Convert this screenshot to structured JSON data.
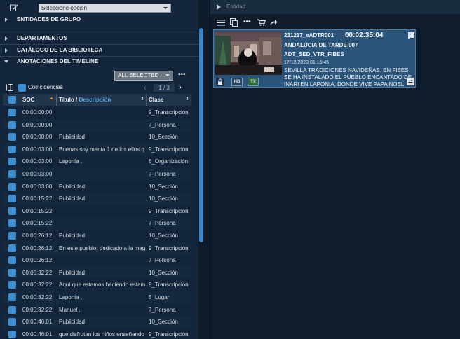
{
  "left": {
    "selector": {
      "value": "Seleccione opción"
    },
    "sections": [
      {
        "label": "ENTIDADES DE GRUPO",
        "expanded": false
      },
      {
        "label": "DEPARTAMENTOS",
        "expanded": false
      },
      {
        "label": "CATÁLOGO DE LA BIBLIOTECA",
        "expanded": false
      },
      {
        "label": "ANOTACIONES DEL TIMELINE",
        "expanded": true
      }
    ],
    "filter": {
      "value": "ALL SELECTED",
      "more": "•••"
    },
    "coincidencias": {
      "label": "Coincidencias",
      "page": "1 / 3",
      "prev": "‹",
      "next": "›"
    },
    "table": {
      "headers": {
        "soc": "SOC",
        "soc_sort": "▲",
        "titulo": "Título",
        "slash": " / ",
        "descripcion": "Descripción",
        "sort": "⬍",
        "clase": "Clase"
      },
      "rows": [
        {
          "soc": "00:00:00:00",
          "titulo": "",
          "clase": "9_Transcripción"
        },
        {
          "soc": "00:00:00:00",
          "titulo": "",
          "clase": "7_Persona"
        },
        {
          "soc": "00:00:00:00",
          "titulo": "Publicidad",
          "clase": "10_Sección"
        },
        {
          "soc": "00:00:03:00",
          "titulo": "Buenas soy menta 1 de los ellos q",
          "clase": "9_Transcripción"
        },
        {
          "soc": "00:00:03:00",
          "titulo": "Laponia ,",
          "clase": "6_Organización"
        },
        {
          "soc": "00:00:03:00",
          "titulo": "",
          "clase": "7_Persona"
        },
        {
          "soc": "00:00:03:00",
          "titulo": "Publicidad",
          "clase": "10_Sección"
        },
        {
          "soc": "00:00:15:22",
          "titulo": "Publicidad",
          "clase": "10_Sección"
        },
        {
          "soc": "00:00:15:22",
          "titulo": "",
          "clase": "9_Transcripción"
        },
        {
          "soc": "00:00:15:22",
          "titulo": "",
          "clase": "7_Persona"
        },
        {
          "soc": "00:00:26:12",
          "titulo": "Publicidad",
          "clase": "10_Sección"
        },
        {
          "soc": "00:00:26:12",
          "titulo": "En este pueblo, dedicado a la mag",
          "clase": "9_Transcripción"
        },
        {
          "soc": "00:00:26:12",
          "titulo": "",
          "clase": "7_Persona"
        },
        {
          "soc": "00:00:32:22",
          "titulo": "Publicidad",
          "clase": "10_Sección"
        },
        {
          "soc": "00:00:32:22",
          "titulo": "Aquí que estamos haciendo estam",
          "clase": "9_Transcripción"
        },
        {
          "soc": "00:00:32:22",
          "titulo": "Laponia ,",
          "clase": "5_Lugar"
        },
        {
          "soc": "00:00:32:22",
          "titulo": "Manuel ,",
          "clase": "7_Persona"
        },
        {
          "soc": "00:00:46:01",
          "titulo": "Publicidad",
          "clase": "10_Sección"
        },
        {
          "soc": "00:00:46:01",
          "titulo": "que disfrutan los niños enseñando",
          "clase": "9_Transcripción"
        }
      ]
    }
  },
  "right": {
    "entidad_label": "Entidad",
    "toolbar_more": "•••",
    "card": {
      "id": "231217_eADTR001",
      "timecode": "00:02:35:04",
      "program": "ANDALUCIA DE TARDE 007",
      "code": "ADT_SED_VTR_FIBES",
      "datetime": "17/12/2023 01:15:45",
      "description": "SEVILLA TRADICIONES NAVIDEÑAS. EN FIBES SE HA INSTALADO EL PUEBLO ENCANTADO DE INARI EN LAPONIA, DONDE VIVE PAPA NOEL",
      "badges": {
        "hd": "HD",
        "tx": "TX"
      }
    }
  },
  "colors": {
    "accent": "#3d8fd0",
    "card": "#2a547a",
    "sort_active": "#e58a3a"
  }
}
